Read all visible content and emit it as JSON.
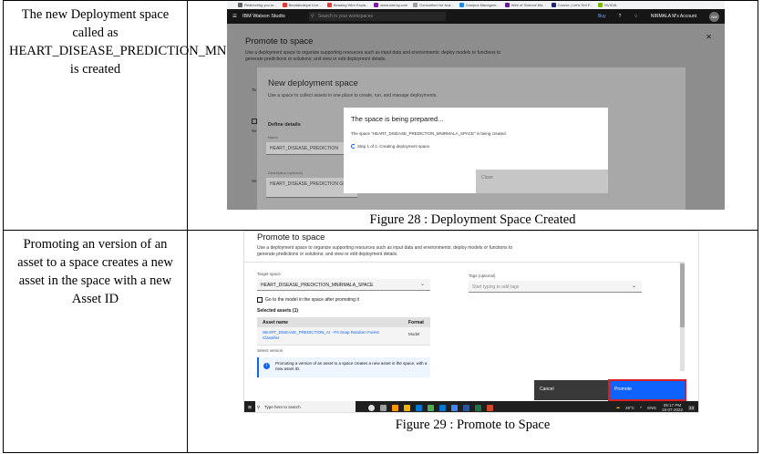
{
  "rows": [
    {
      "left_text": "The new Deployment space called as HEART_DISEASE_PREDICTION_MNIRMALA_SPACE is created",
      "caption": "Figure 28 : Deployment Space Created",
      "screenshot": {
        "bookmarks": [
          "Redirecting you to...",
          "Beadaholique Live...",
          "Beading Wire Expla...",
          "www.udemy.com",
          "Consortium for Aca...",
          "Campus Managem...",
          "Web of Science Ma...",
          "Course | Let's Get F...",
          "NVIDIA"
        ],
        "app_name": "IBM Watson Studio",
        "search_placeholder": "Search in your workspaces",
        "buy_label": "Buy",
        "account_label": "NIRMALA M's Account",
        "avatar_initials": "NM",
        "promote_title": "Promote to space",
        "promote_desc": "Use a deployment space to organize supporting resources such as input data and environments; deploy models or functions to generate predictions or solutions; and view or edit deployment details.",
        "newdep_title": "New deployment space",
        "newdep_desc": "Use a space to collect assets in one place to create, run, and manage deployments.",
        "define_details": "Define details",
        "name_label": "Name",
        "name_value": "HEART_DISEASE_PREDICTION",
        "desc_label": "Description (optional)",
        "desc_value": "HEART_DISEASE_PREDICTION GIVEN",
        "side_labels": [
          "Ta",
          "Se",
          "Se"
        ],
        "modal_title": "The space is being prepared...",
        "modal_desc": "The space \"HEART_DISEASE_PREDICTION_MNIRMALA_SPACE\" is being created.",
        "modal_step": "Step 1 of 1: Creating deployment space.",
        "close_label": "Close"
      }
    },
    {
      "left_text": "Promoting an version of an asset to a space creates a new asset in the space with a new Asset ID",
      "caption": "Figure 29 : Promote to Space",
      "screenshot": {
        "title": "Promote to space",
        "desc": "Use a deployment space to organize supporting resources such as input data and environments; deploy models or functions to generate predictions or solutions; and view or edit deployment details.",
        "target_label": "Target space",
        "target_value": "HEART_DISEASE_PREDICTION_MNIRMALA_SPACE",
        "tags_label": "Tags (optional)",
        "tags_placeholder": "Start typing to add tags",
        "goto_label": "Go to the model in the space after promoting it",
        "selected_label": "Selected assets (1)",
        "col_asset": "Asset name",
        "col_format": "Format",
        "asset_name": "HEART_DISEASE_PREDICTION_AI - P4 Snap Random Forest Classifier",
        "asset_format": "Model",
        "version_label": "Select version",
        "info_text": "Promoting a version of an asset to a space creates a new asset in the space, with a new asset ID.",
        "cancel_label": "Cancel",
        "promote_label": "Promote",
        "taskbar_search": "Type here to search",
        "temperature": "29°C",
        "lang": "ENG",
        "time": "05:17 PM",
        "date": "19-07-2022",
        "notif_count": "23"
      }
    }
  ],
  "colors": {
    "ibm_blue": "#0f62fe",
    "ibm_dark": "#161616",
    "highlight_red": "#da1e28"
  }
}
